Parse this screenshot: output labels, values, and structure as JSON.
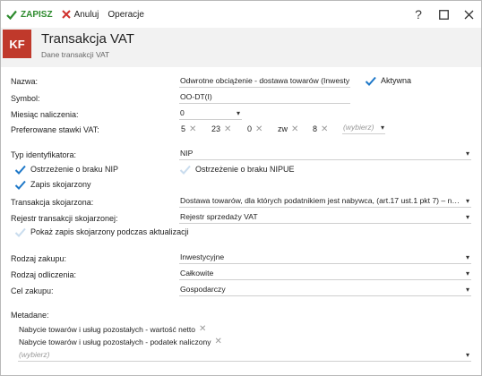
{
  "toolbar": {
    "save_label": "ZAPISZ",
    "cancel_label": "Anuluj",
    "operations_label": "Operacje",
    "help_symbol": "?",
    "colors": {
      "save": "#2e8b2e",
      "cancel": "#d0312d"
    }
  },
  "header": {
    "badge": "KF",
    "badge_color": "#c0392b",
    "title": "Transakcja VAT",
    "subtitle": "Dane transakcji VAT"
  },
  "form": {
    "nazwa": {
      "label": "Nazwa:",
      "value": "Odwrotne obciążenie - dostawa towarów (Inwesty"
    },
    "aktywna": {
      "label": "Aktywna",
      "checked": true
    },
    "symbol": {
      "label": "Symbol:",
      "value": "OO-DT(I)"
    },
    "miesiac": {
      "label": "Miesiąc naliczenia:",
      "value": "0"
    },
    "stawki": {
      "label": "Preferowane stawki VAT:",
      "items": [
        "5",
        "23",
        "0",
        "zw",
        "8"
      ],
      "placeholder": "(wybierz)"
    },
    "typ_id": {
      "label": "Typ identyfikatora:",
      "value": "NIP"
    },
    "ostrzezenie_nip": {
      "label": "Ostrzeżenie o braku NIP",
      "checked": true
    },
    "ostrzezenie_nipue": {
      "label": "Ostrzeżenie o braku NIPUE",
      "checked": false
    },
    "zapis_skojarzony": {
      "label": "Zapis skojarzony",
      "checked": true
    },
    "transakcja_skoj": {
      "label": "Transakcja skojarzona:",
      "value": "Dostawa towarów, dla których podatnikiem jest nabywca, (art.17 ust.1 pkt 7) – n…"
    },
    "rejestr_skoj": {
      "label": "Rejestr transakcji skojarzonej:",
      "value": "Rejestr sprzedaży VAT"
    },
    "pokaz_zapis": {
      "label": "Pokaż zapis skojarzony podczas aktualizacji",
      "checked": false
    },
    "rodzaj_zakupu": {
      "label": "Rodzaj zakupu:",
      "value": "Inwestycyjne"
    },
    "rodzaj_odliczenia": {
      "label": "Rodzaj odliczenia:",
      "value": "Całkowite"
    },
    "cel_zakupu": {
      "label": "Cel zakupu:",
      "value": "Gospodarczy"
    },
    "metadane": {
      "label": "Metadane:",
      "items": [
        "Nabycie towarów i usług pozostałych - wartość netto",
        "Nabycie towarów i usług pozostałych - podatek naliczony"
      ],
      "placeholder": "(wybierz)"
    }
  }
}
